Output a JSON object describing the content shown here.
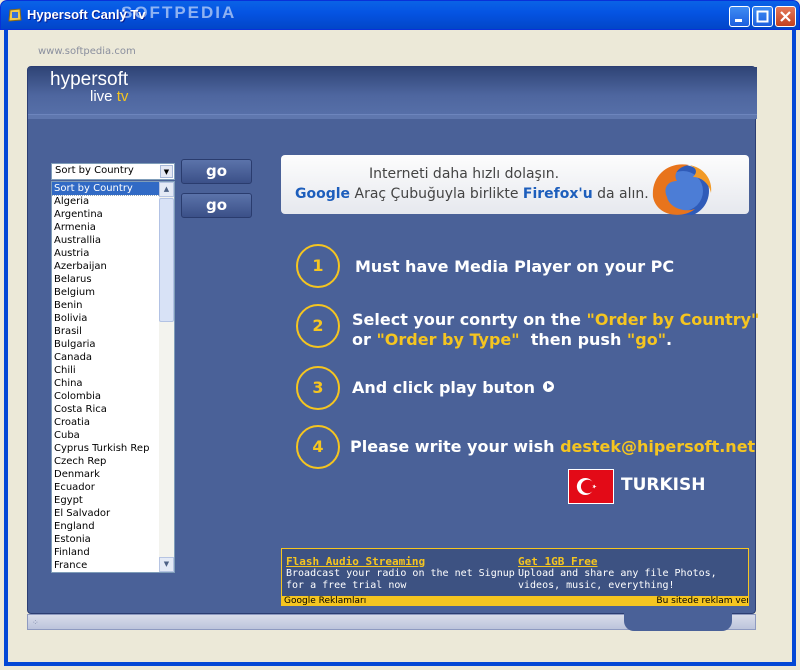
{
  "window": {
    "title": "Hypersoft Canlý Tv",
    "watermark_top": "SOFTPEDIA",
    "watermark_site": "www.softpedia.com"
  },
  "logo": {
    "line1": "hypersoft",
    "line2a": "live",
    "line2b": "tv"
  },
  "sort": {
    "selected": "Sort by Country"
  },
  "countries": [
    "Sort by Country",
    "Algeria",
    "Argentina",
    "Armenia",
    "Australlia",
    "Austria",
    "Azerbaijan",
    "Belarus",
    "Belgium",
    "Benin",
    "Bolivia",
    "Brasil",
    "Bulgaria",
    "Canada",
    "Chili",
    "China",
    "Colombia",
    "Costa Rica",
    "Croatia",
    "Cuba",
    "Cyprus Turkish Rep",
    "Czech Rep",
    "Denmark",
    "Ecuador",
    "Egypt",
    "El Salvador",
    "England",
    "Estonia",
    "Finland",
    "France"
  ],
  "buttons": {
    "go1": "go",
    "go2": "go"
  },
  "firefox_banner": {
    "line1": "Interneti daha hızlı dolaşın.",
    "google": "Google",
    "mid": " Araç Çubuğuyla birlikte ",
    "firefox": "Firefox'u",
    "end": " da alın."
  },
  "steps": {
    "n1": "1",
    "t1": "Must have Media Player on your PC",
    "n2": "2",
    "t2a": "Select your conrty on the ",
    "t2b": "\"Order by Country\"",
    "t2c": "or ",
    "t2d": "\"Order by Type\"",
    "t2e": "  then push ",
    "t2f": "\"go\"",
    "t2g": ".",
    "n3": "3",
    "t3": "And click play buton",
    "n4": "4",
    "t4a": "Please write your wish ",
    "t4b": "destek@hipersoft.net"
  },
  "language": "TURKISH",
  "ads": {
    "ad1_title": "Flash Audio Streaming",
    "ad1_l1": "Broadcast your radio on the net Signup",
    "ad1_l2": "for a free trial now",
    "ad2_title": "Get 1GB Free",
    "ad2_l1": "Upload and share any file Photos,",
    "ad2_l2": "videos, music, everything!",
    "foot_left": "Google Reklamları",
    "foot_right": "Bu sitede reklam ver"
  },
  "colors": {
    "accent": "#F5C520",
    "panel": "#4A6198",
    "titlebar": "#0554E3"
  }
}
